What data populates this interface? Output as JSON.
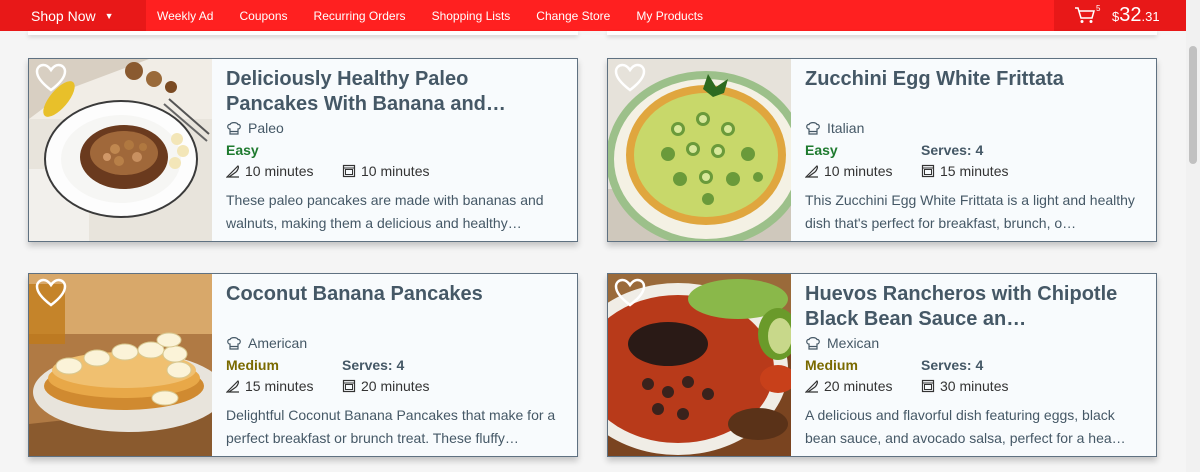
{
  "header": {
    "shop_now": "Shop Now",
    "nav": [
      "Weekly Ad",
      "Coupons",
      "Recurring Orders",
      "Shopping Lists",
      "Change Store",
      "My Products"
    ],
    "cart_count": "5",
    "price_symbol": "$",
    "price_dollars": "32",
    "price_cents": ".31"
  },
  "colors": {
    "brand_red": "#ff2020",
    "easy": "#1e7a2e",
    "medium": "#7a6a00",
    "text": "#455866"
  },
  "recipes": [
    {
      "title": "Deliciously Healthy Paleo Pancakes With Banana and…",
      "cuisine": "Paleo",
      "difficulty": "Easy",
      "serves": "",
      "prep": "10 minutes",
      "cook": "10 minutes",
      "description": "These paleo pancakes are made with bananas and walnuts, making them a delicious and healthy…"
    },
    {
      "title": "Zucchini Egg White Frittata",
      "cuisine": "Italian",
      "difficulty": "Easy",
      "serves": "Serves: 4",
      "prep": "10 minutes",
      "cook": "15 minutes",
      "description": "This Zucchini Egg White Frittata is a light and healthy dish that's perfect for breakfast, brunch, o…"
    },
    {
      "title": "Coconut Banana Pancakes",
      "cuisine": "American",
      "difficulty": "Medium",
      "serves": "Serves: 4",
      "prep": "15 minutes",
      "cook": "20 minutes",
      "description": "Delightful Coconut Banana Pancakes that make for a perfect breakfast or brunch treat. These fluffy…"
    },
    {
      "title": "Huevos Rancheros with Chipotle Black Bean Sauce an…",
      "cuisine": "Mexican",
      "difficulty": "Medium",
      "serves": "Serves: 4",
      "prep": "20 minutes",
      "cook": "30 minutes",
      "description": "A delicious and flavorful dish featuring eggs, black bean sauce, and avocado salsa, perfect for a hea…"
    }
  ]
}
